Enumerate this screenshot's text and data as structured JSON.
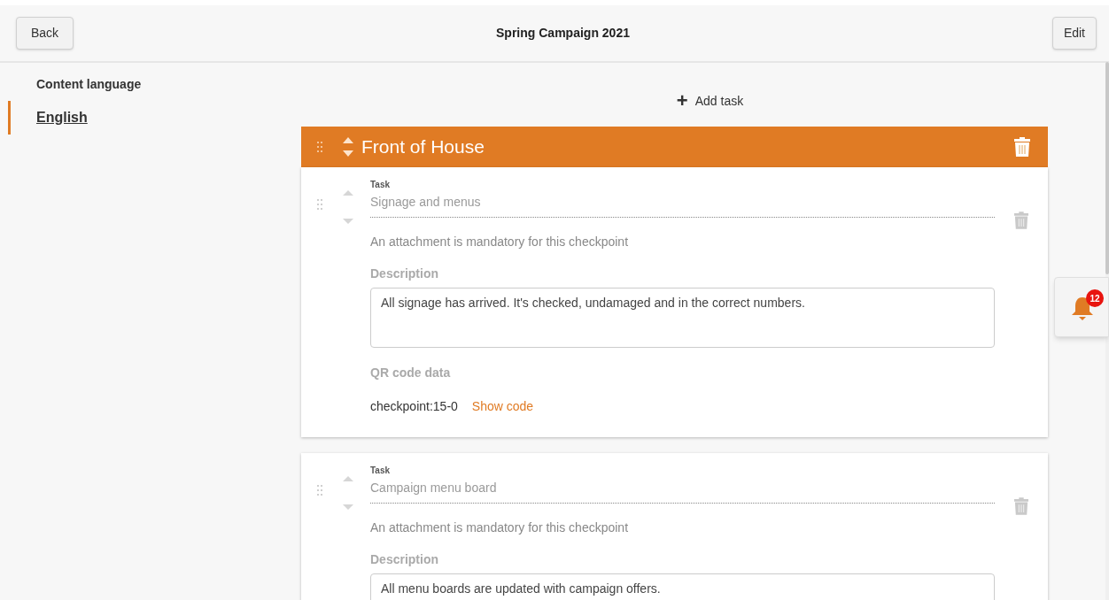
{
  "header": {
    "back": "Back",
    "title": "Spring Campaign 2021",
    "edit": "Edit"
  },
  "sidebar": {
    "heading": "Content language",
    "languages": [
      {
        "label": "English",
        "selected": true
      }
    ]
  },
  "add_task": {
    "icon": "+",
    "label": "Add task"
  },
  "section": {
    "title": "Front of House"
  },
  "tasks": [
    {
      "task_label": "Task",
      "task_value": "Signage and menus",
      "note": "An attachment is mandatory for this checkpoint",
      "description_label": "Description",
      "description": "All signage has arrived. It's checked, undamaged and in the correct numbers.",
      "qr_label": "QR code data",
      "qr_value": "checkpoint:15-0",
      "qr_link": "Show code"
    },
    {
      "task_label": "Task",
      "task_value": "Campaign menu board",
      "note": "An attachment is mandatory for this checkpoint",
      "description_label": "Description",
      "description": "All menu boards are updated with campaign offers."
    }
  ],
  "notifications": {
    "count": "12"
  }
}
